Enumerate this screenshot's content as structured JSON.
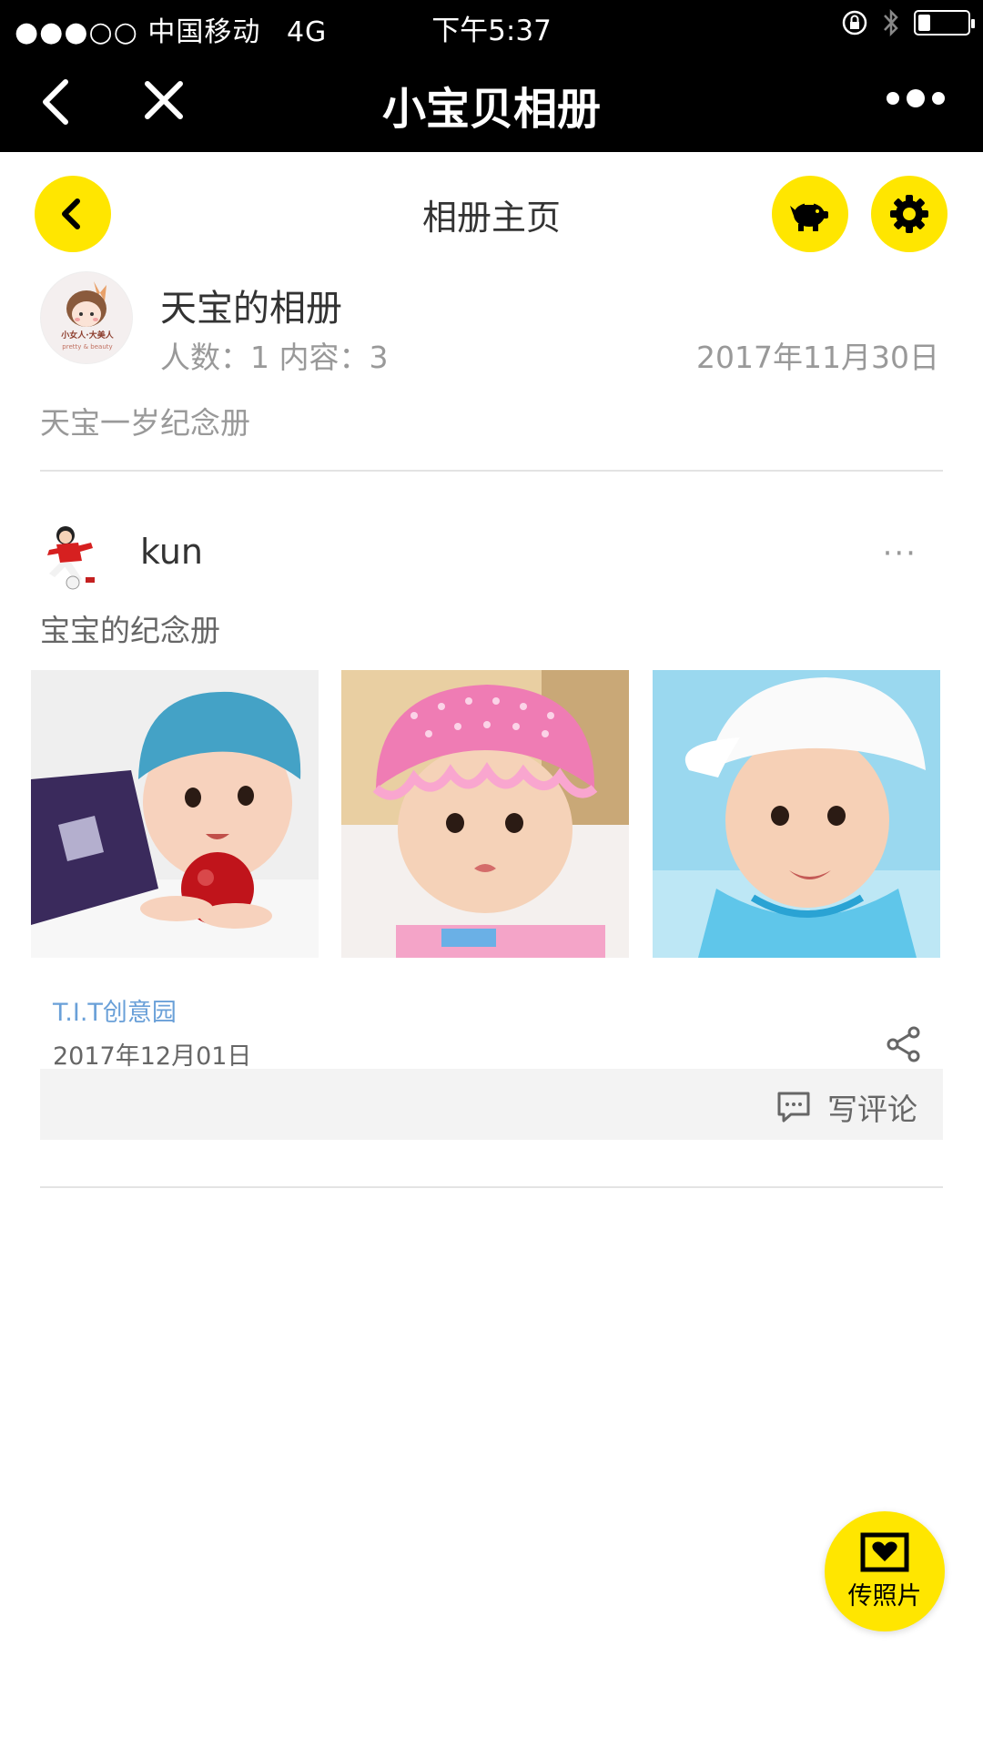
{
  "status_bar": {
    "carrier": "●●●○○ 中国移动",
    "network": "4G",
    "time": "下午5:37",
    "battery_level": 0.25
  },
  "nav_bar": {
    "title": "小宝贝相册",
    "back_icon": "chevron-left-icon",
    "close_icon": "close-icon",
    "more_icon": "more-dots-icon"
  },
  "page": {
    "title": "相册主页",
    "back_icon": "chevron-left-icon",
    "piggy_icon": "piggy-bank-icon",
    "settings_icon": "gear-icon",
    "accent_color": "#ffe600"
  },
  "album": {
    "name": "天宝的相册",
    "stats": "人数：1 内容：3",
    "date": "2017年11月30日",
    "description": "天宝一岁纪念册",
    "avatar_text": "小女人·大美人",
    "avatar_subtext": "pretty & beauty"
  },
  "post": {
    "user": "kun",
    "more": "···",
    "caption": "宝宝的纪念册",
    "photos": [
      "baby-blue-hat",
      "baby-pink-hat",
      "baby-white-cap"
    ],
    "source": "T.I.T创意园",
    "date": "2017年12月01日",
    "comment_label": "写评论",
    "source_color": "#6aa0d8"
  },
  "fab": {
    "label": "传照片",
    "icon": "photo-heart-icon"
  }
}
